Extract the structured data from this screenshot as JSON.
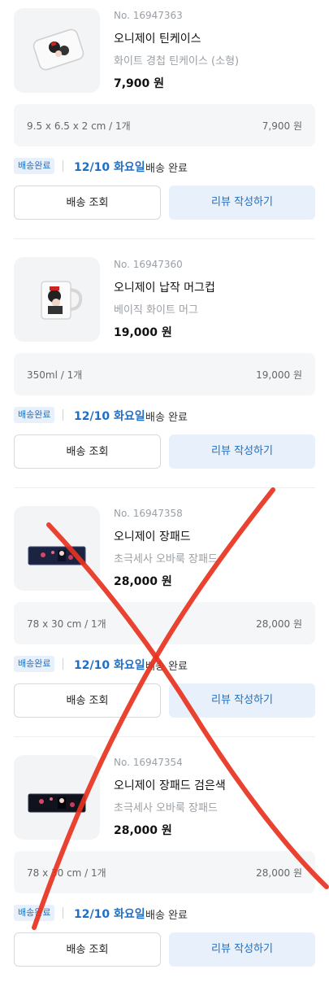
{
  "orders": [
    {
      "product_no": "No. 16947363",
      "name": "오니제이 틴케이스",
      "option": "화이트 경첩 틴케이스 (소형)",
      "price": "7,900 원",
      "spec": "9.5 x 6.5 x 2 cm /  1개",
      "line_total": "7,900 원",
      "status_badge": "배송완료",
      "delivery_date": "12/10 화요일",
      "delivery_text": "배송 완료",
      "track_label": "배송 조회",
      "review_label": "리뷰 작성하기",
      "image_kind": "tin-case"
    },
    {
      "product_no": "No. 16947360",
      "name": "오니제이 납작 머그컵",
      "option": "베이직 화이트 머그",
      "price": "19,000 원",
      "spec": "350ml /  1개",
      "line_total": "19,000 원",
      "status_badge": "배송완료",
      "delivery_date": "12/10 화요일",
      "delivery_text": "배송 완료",
      "track_label": "배송 조회",
      "review_label": "리뷰 작성하기",
      "image_kind": "mug"
    },
    {
      "product_no": "No. 16947358",
      "name": "오니제이 장패드",
      "option": "초극세사 오바룩 장패드",
      "price": "28,000 원",
      "spec": "78 x 30 cm /  1개",
      "line_total": "28,000 원",
      "status_badge": "배송완료",
      "delivery_date": "12/10 화요일",
      "delivery_text": "배송 완료",
      "track_label": "배송 조회",
      "review_label": "리뷰 작성하기",
      "image_kind": "desk-pad"
    },
    {
      "product_no": "No. 16947354",
      "name": "오니제이 장패드 검은색",
      "option": "초극세사 오바룩 장패드",
      "price": "28,000 원",
      "spec": "78 x 30 cm /  1개",
      "line_total": "28,000 원",
      "status_badge": "배송완료",
      "delivery_date": "12/10 화요일",
      "delivery_text": "배송 완료",
      "track_label": "배송 조회",
      "review_label": "리뷰 작성하기",
      "image_kind": "desk-pad-black"
    }
  ],
  "overlay": {
    "mark": "red-x-cross",
    "color": "#e8321e"
  },
  "colors": {
    "accent": "#1f6fc5",
    "badge_bg": "#e8f1fb",
    "muted": "#9aa0a6"
  }
}
